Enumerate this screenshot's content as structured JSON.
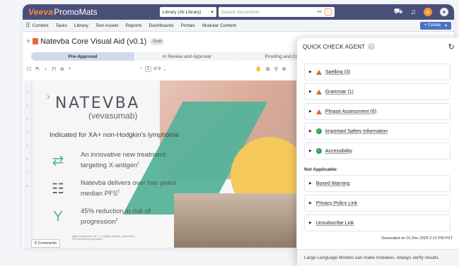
{
  "header": {
    "brand": "Veeva",
    "product": "PromoMats",
    "library_select": "Library (All Library)",
    "search_placeholder": "Search documents"
  },
  "nav": {
    "items": [
      "Content",
      "Tasks",
      "Library",
      "Text Assets",
      "Reports",
      "Dashboards",
      "Portals",
      "Modular Content"
    ],
    "create_label": "+ Create"
  },
  "document": {
    "title": "Natevba Core Visual Aid (v0.1)",
    "status": "Draft",
    "comments": "8 Comments"
  },
  "lifecycle": {
    "stages": [
      "Pre-Approval",
      "In Review and Approval",
      "Proofing and Compliance"
    ]
  },
  "viewer": {
    "page": "1",
    "page_total": "of 8",
    "ruler": [
      "1",
      "2",
      "3",
      "4",
      "5",
      "6",
      "7",
      "8"
    ]
  },
  "content": {
    "brand_name": "NATEVBA",
    "generic_name": "(vevasumab)",
    "indication": "Indicated for XA+ non-Hodgkin's lymphoma",
    "features": [
      {
        "line1": "An innovative new treatment",
        "line2": "targeting X-antigen",
        "ref": "1"
      },
      {
        "line1": "Natevba delivers over two years",
        "line2": "median PFS",
        "ref": "2"
      },
      {
        "line1": "45% reduction in risk of",
        "line2": "progression",
        "ref": "2"
      }
    ],
    "footnote": "kgkin's lymphoma; XA+ = X-antigen positive; xccessively Full Prescribing Information."
  },
  "quick_check": {
    "title": "QUICK CHECK AGENT",
    "checks": [
      {
        "label": "Spelling (3)",
        "status": "warning"
      },
      {
        "label": "Grammar (1)",
        "status": "warning"
      },
      {
        "label": "Phrase Assessment (6)",
        "status": "warning"
      },
      {
        "label": "Important Safety Information",
        "status": "pass"
      },
      {
        "label": "Accessibility",
        "status": "pass"
      }
    ],
    "not_applicable_label": "Not Applicable:",
    "not_applicable": [
      {
        "label": "Boxed Warning"
      },
      {
        "label": "Privacy Policy Link"
      },
      {
        "label": "Unsubscribe Link"
      }
    ],
    "generated": "Generated on 01 Dec 2025 2:13 PM PST",
    "disclaimer": "Large Language Models can make mistakes. Always verify results."
  },
  "colors": {
    "topbar": "#4a4f7a",
    "brand_orange": "#f08a3c",
    "teal": "#56b39a",
    "warning": "#e0652f",
    "pass": "#2f9e5a"
  }
}
